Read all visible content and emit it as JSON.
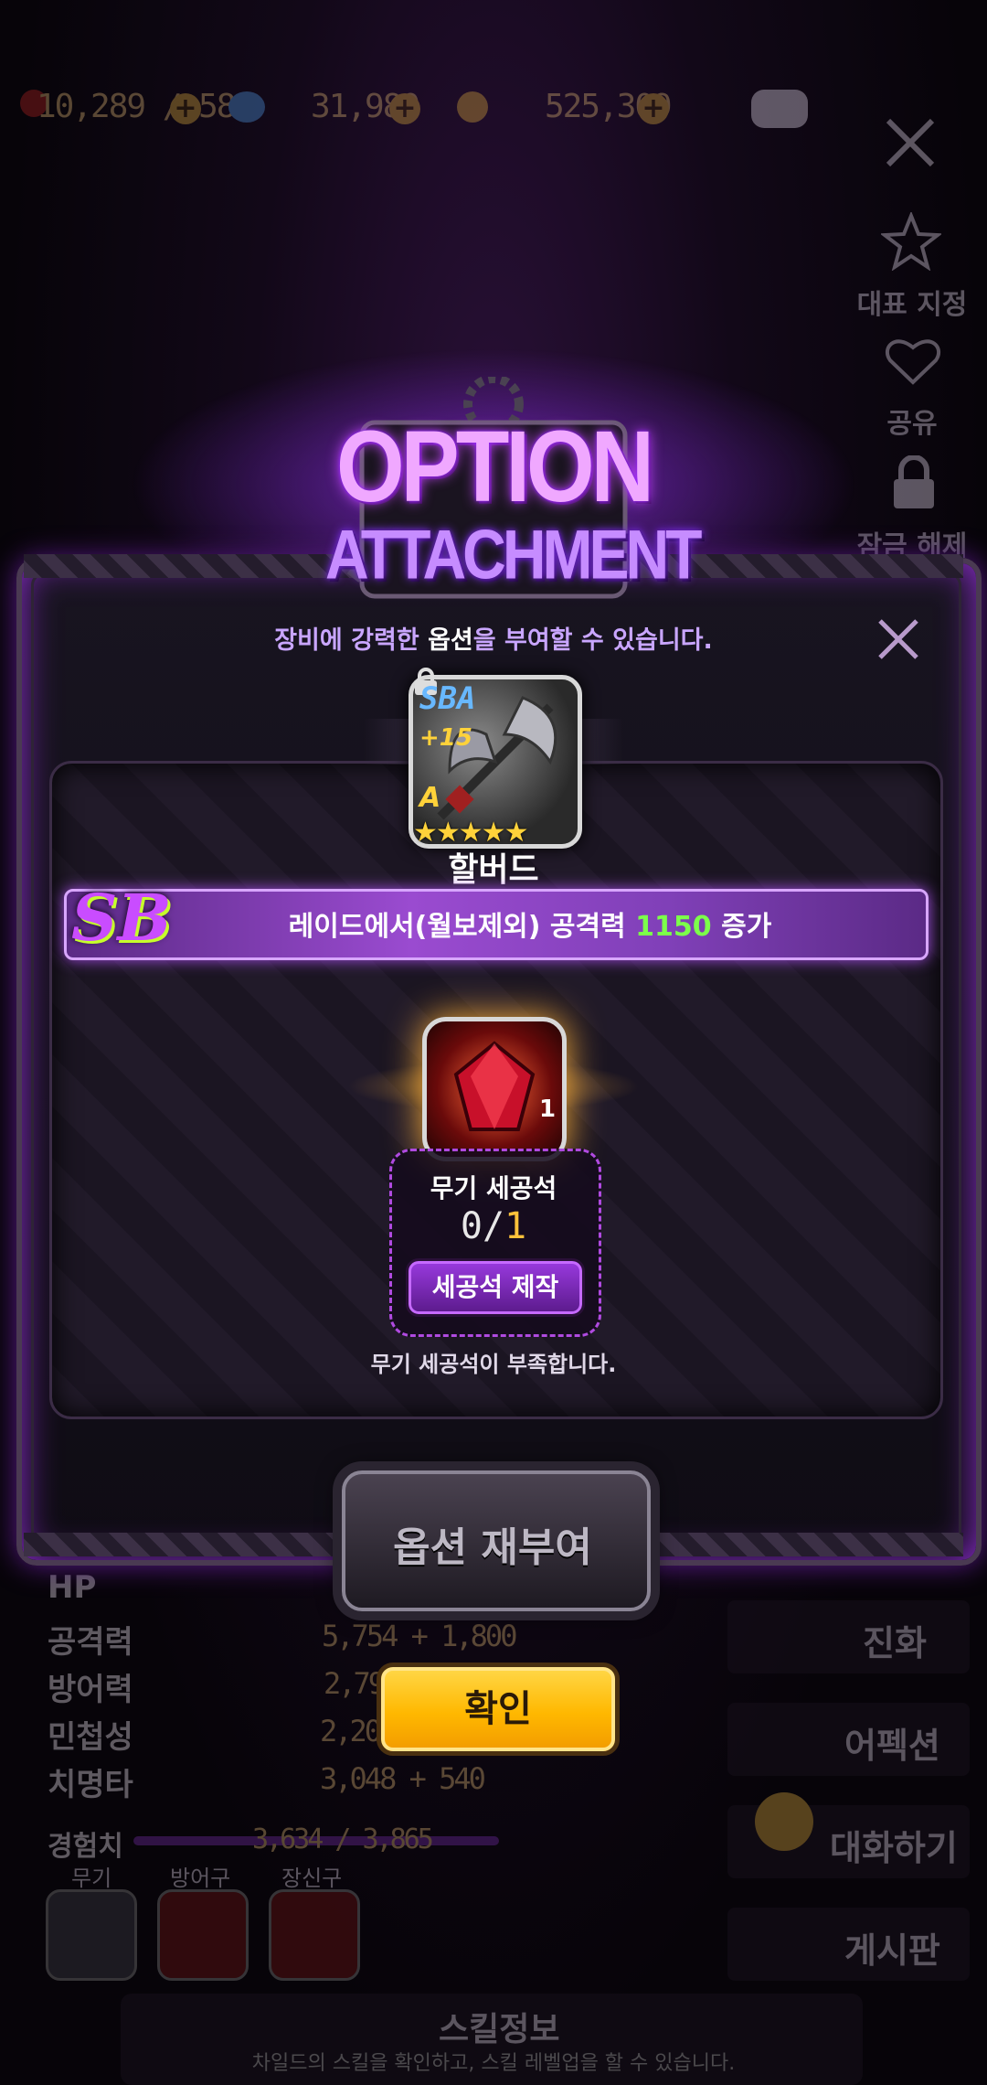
{
  "top_bar": {
    "stamina": "10,289 / 584",
    "gems": "31,980",
    "gold": "525,309"
  },
  "side_menu": {
    "representative_label": "대표 지정",
    "share_label": "공유",
    "unlock_label": "잠금 해제"
  },
  "stats": {
    "hp_label": "HP",
    "attack_label": "공격력",
    "attack_value": "5,754 + 1,800",
    "defense_label": "방어력",
    "defense_value": "2,790",
    "agility_label": "민첩성",
    "agility_value": "2,200",
    "crit_label": "치명타",
    "crit_value": "3,048 + 540",
    "exp_label": "경험치",
    "exp_value": "3,634 / 3,865"
  },
  "equipment_tabs": {
    "weapon": "무기",
    "armor": "방어구",
    "accessory": "장신구"
  },
  "right_menu": {
    "evolution": "진화",
    "ascension": "어펙션",
    "talk": "대화하기",
    "board": "게시판"
  },
  "skill_info": {
    "title": "스킬정보",
    "description": "차일드의 스킬을 확인하고, 스킬 레벨업을 할 수 있습니다."
  },
  "modal": {
    "title_line1": "OPTION",
    "title_line2": "ATTACHMENT",
    "subtitle_prefix": "장비에 강력한 ",
    "subtitle_highlight": "옵션",
    "subtitle_suffix": "을 부여할 수 있습니다.",
    "weapon": {
      "grade": "SBA",
      "enhance": "+15",
      "rank": "A",
      "stars": "★★★★★",
      "star_count": 5,
      "name": "할버드"
    },
    "option": {
      "badge": "SB",
      "text_prefix": "레이드에서(월보제외) 공격력 ",
      "value": "1150",
      "text_suffix": " 증가"
    },
    "material": {
      "stack_count": "1",
      "name": "무기 세공석",
      "owned": "0",
      "separator": "/",
      "required": "1",
      "craft_button": "세공석 제작",
      "insufficient_text": "무기 세공석이 부족합니다."
    },
    "rebuild_button": "옵션 재부여",
    "confirm_button": "확인"
  },
  "colors": {
    "accent_purple": "#a04ae0",
    "option_value_green": "#7cff4a",
    "required_gold": "#ffc23a",
    "confirm_yellow": "#ffb800"
  }
}
